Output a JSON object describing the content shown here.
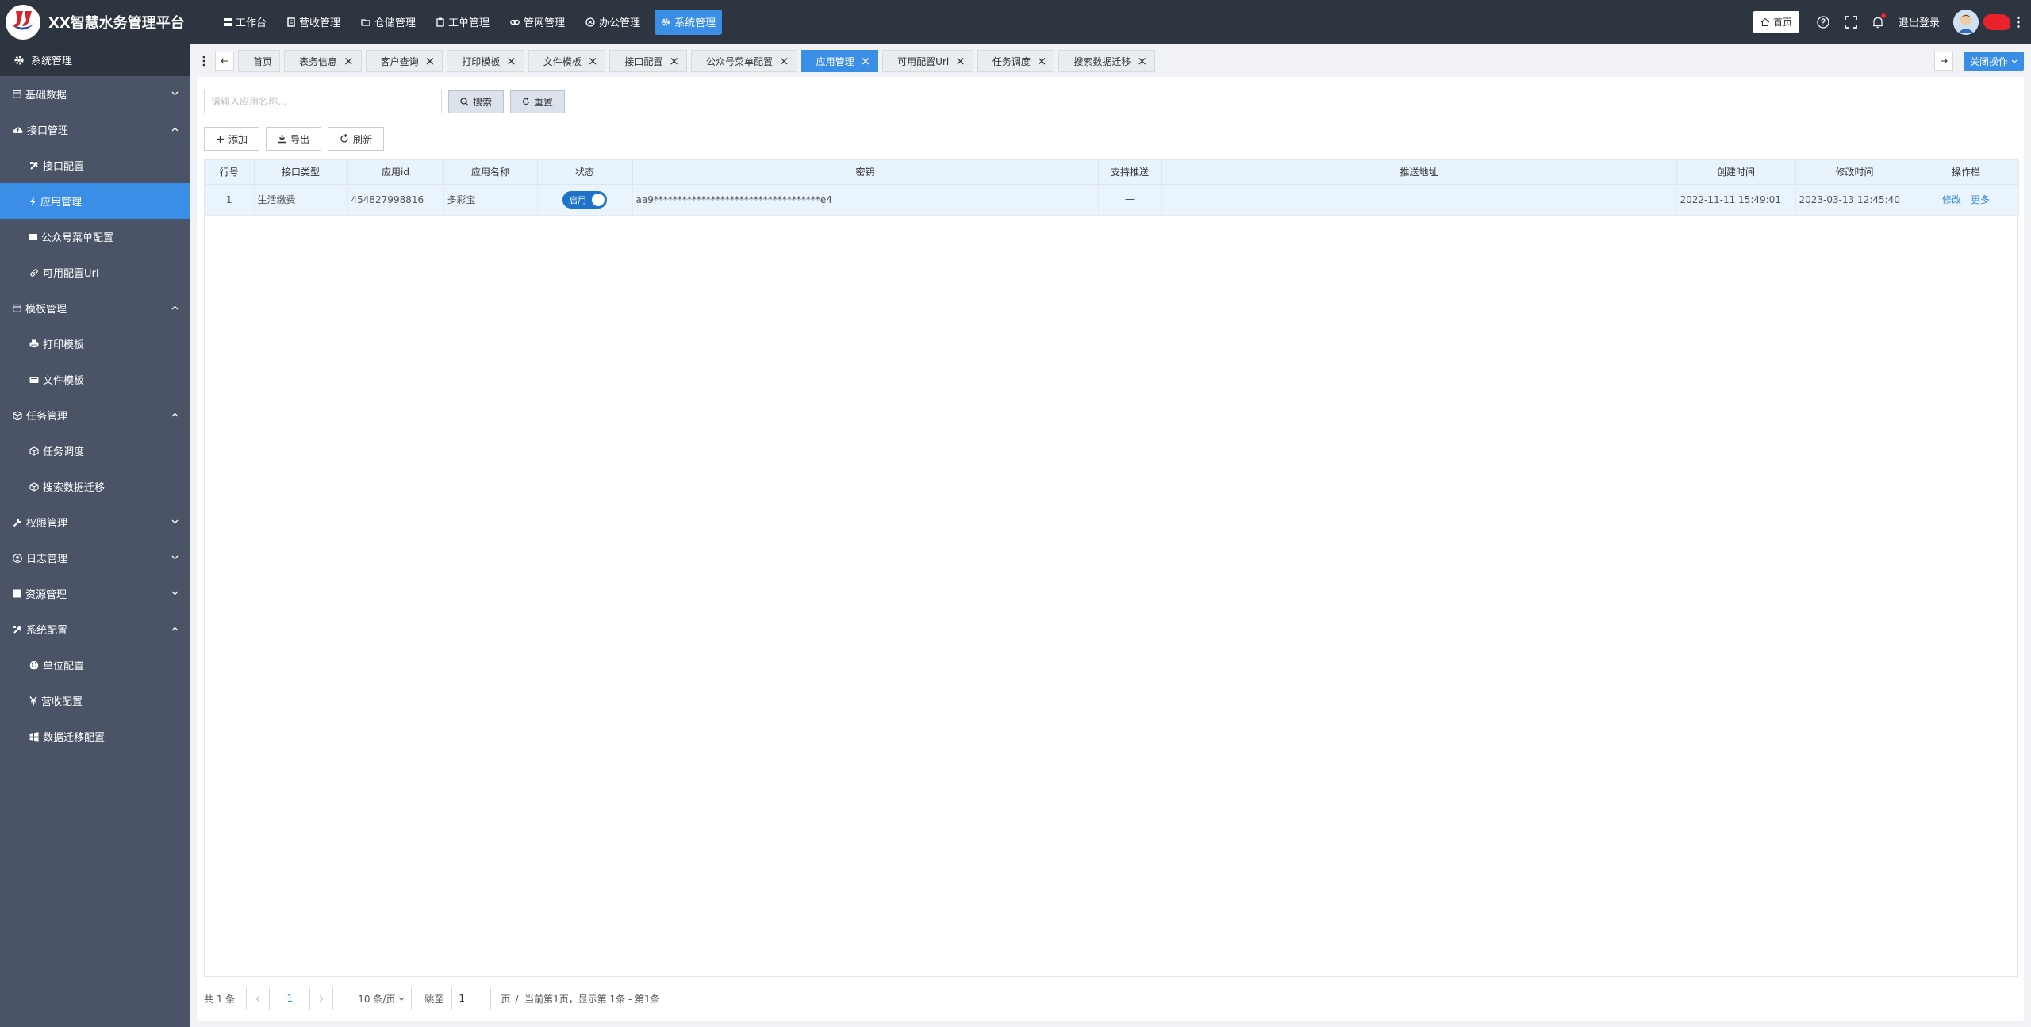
{
  "app": {
    "title": "XX智慧水务管理平台"
  },
  "topnav": [
    {
      "label": "工作台",
      "icon": "dashboard-icon"
    },
    {
      "label": "营收管理",
      "icon": "receipt-icon"
    },
    {
      "label": "仓储管理",
      "icon": "folder-icon"
    },
    {
      "label": "工单管理",
      "icon": "clipboard-icon"
    },
    {
      "label": "管网管理",
      "icon": "link-icon"
    },
    {
      "label": "办公管理",
      "icon": "office-icon"
    },
    {
      "label": "系统管理",
      "icon": "gear-icon",
      "active": true
    }
  ],
  "topright": {
    "home_label": "首页",
    "logout_label": "退出登录"
  },
  "sidebar": {
    "header": "系统管理",
    "items": [
      {
        "label": "基础数据",
        "type": "group",
        "icon": "calendar-icon",
        "expanded": false
      },
      {
        "label": "接口管理",
        "type": "group",
        "icon": "cloud-icon",
        "expanded": true
      },
      {
        "label": "接口配置",
        "type": "sub",
        "icon": "tools-icon"
      },
      {
        "label": "应用管理",
        "type": "sub",
        "icon": "bolt-icon",
        "active": true
      },
      {
        "label": "公众号菜单配置",
        "type": "sub",
        "icon": "menu-icon"
      },
      {
        "label": "可用配置Url",
        "type": "sub",
        "icon": "link-icon"
      },
      {
        "label": "模板管理",
        "type": "group",
        "icon": "calendar-icon",
        "expanded": true
      },
      {
        "label": "打印模板",
        "type": "sub",
        "icon": "printer-icon"
      },
      {
        "label": "文件模板",
        "type": "sub",
        "icon": "keyboard-icon"
      },
      {
        "label": "任务管理",
        "type": "group",
        "icon": "cube-icon",
        "expanded": true
      },
      {
        "label": "任务调度",
        "type": "sub",
        "icon": "cube-icon"
      },
      {
        "label": "搜索数据迁移",
        "type": "sub",
        "icon": "cube-icon"
      },
      {
        "label": "权限管理",
        "type": "group",
        "icon": "wrench-icon",
        "expanded": false
      },
      {
        "label": "日志管理",
        "type": "group",
        "icon": "user-circle-icon",
        "expanded": false
      },
      {
        "label": "资源管理",
        "type": "group",
        "icon": "square-icon",
        "expanded": false
      },
      {
        "label": "系统配置",
        "type": "group",
        "icon": "tools-icon",
        "expanded": true
      },
      {
        "label": "单位配置",
        "type": "sub",
        "icon": "globe-icon"
      },
      {
        "label": "营收配置",
        "type": "sub",
        "icon": "yen-icon"
      },
      {
        "label": "数据迁移配置",
        "type": "sub",
        "icon": "windows-icon"
      }
    ]
  },
  "tabs": [
    {
      "label": "首页",
      "closable": false
    },
    {
      "label": "表务信息",
      "closable": true
    },
    {
      "label": "客户查询",
      "closable": true
    },
    {
      "label": "打印模板",
      "closable": true
    },
    {
      "label": "文件模板",
      "closable": true
    },
    {
      "label": "接口配置",
      "closable": true
    },
    {
      "label": "公众号菜单配置",
      "closable": true
    },
    {
      "label": "应用管理",
      "closable": true,
      "active": true
    },
    {
      "label": "可用配置Url",
      "closable": true
    },
    {
      "label": "任务调度",
      "closable": true
    },
    {
      "label": "搜索数据迁移",
      "closable": true
    }
  ],
  "tabs_close_ops": "关闭操作",
  "search": {
    "placeholder": "请输入应用名称...",
    "search_label": "搜索",
    "reset_label": "重置"
  },
  "toolbar": {
    "add_label": "添加",
    "export_label": "导出",
    "refresh_label": "刷新"
  },
  "table": {
    "columns": [
      "行号",
      "接口类型",
      "应用id",
      "应用名称",
      "状态",
      "密钥",
      "支持推送",
      "推送地址",
      "创建时间",
      "修改时间",
      "操作栏"
    ],
    "rows": [
      {
        "index": "1",
        "type": "生活缴费",
        "app_id": "454827998816",
        "app_name": "多彩宝",
        "status": "启用",
        "secret": "aa9***********************************e4",
        "push": "一",
        "push_url": "",
        "created": "2022-11-11 15:49:01",
        "modified": "2023-03-13 12:45:40",
        "edit": "修改",
        "more": "更多"
      }
    ]
  },
  "pagination": {
    "total": "共 1 条",
    "current_page": "1",
    "page_size": "10 条/页",
    "jump_label": "跳至",
    "jump_value": "1",
    "page_suffix": "页",
    "summary": "/  当前第1页，显示第 1条 - 第1条"
  },
  "colors": {
    "primary": "#3a8ee6",
    "topbar": "#2d3541",
    "sidebar": "#4a5466"
  }
}
